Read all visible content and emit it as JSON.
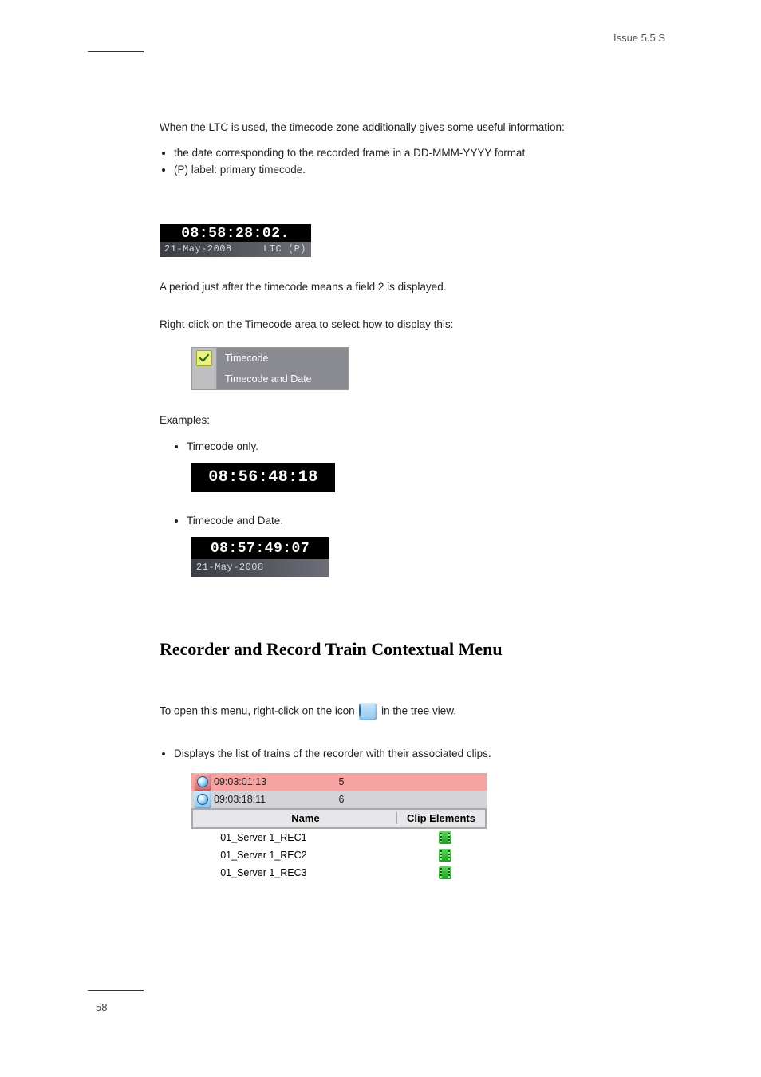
{
  "header": {
    "right": "Issue 5.5.S"
  },
  "page_number": "58",
  "when_para": "When the LTC is used, the timecode zone additionally gives some useful information:",
  "when_bullets": [
    "the date corresponding to the recorded frame in a DD-MMM-YYYY format",
    "(P) label: primary timecode."
  ],
  "tc_widget_1": {
    "tc": "08:58:28:02.",
    "date": "21-May-2008",
    "marker": "LTC (P)"
  },
  "para_period": "A period just after the timecode means a field 2 is displayed.",
  "para_rightclick": "Right-click on the Timecode area to select how to display this:",
  "ctx_menu": {
    "option1": "Timecode",
    "option2": "Timecode and Date"
  },
  "examples_intro": "Examples:",
  "example_tc_label": "Timecode only.",
  "example_tc_only": "08:56:48:18",
  "example_tcd_label": "Timecode and Date.",
  "example_tcd_tc": "08:57:49:07",
  "example_tcd_date": "21-May-2008",
  "record_section_title": "Recorder and Record Train Contextual Menu",
  "record_para_before_icon": "To open this menu, right-click on the icon ",
  "record_para_after_icon": " in the tree view.",
  "record_list_text": "Displays the list of trains of the recorder with their associated clips.",
  "record_rows": [
    {
      "tc": "09:03:01:13",
      "num": "5",
      "tone": "red"
    },
    {
      "tc": "09:03:18:11",
      "num": "6",
      "tone": "blue"
    }
  ],
  "table_headers": {
    "name": "Name",
    "clip": "Clip Elements"
  },
  "table_rows": [
    {
      "name": "01_Server 1_REC1"
    },
    {
      "name": "01_Server 1_REC2"
    },
    {
      "name": "01_Server 1_REC3"
    }
  ],
  "icon_names": {
    "checkbox": "check-icon",
    "recorder": "recorder-icon",
    "film": "film-clip-icon"
  }
}
